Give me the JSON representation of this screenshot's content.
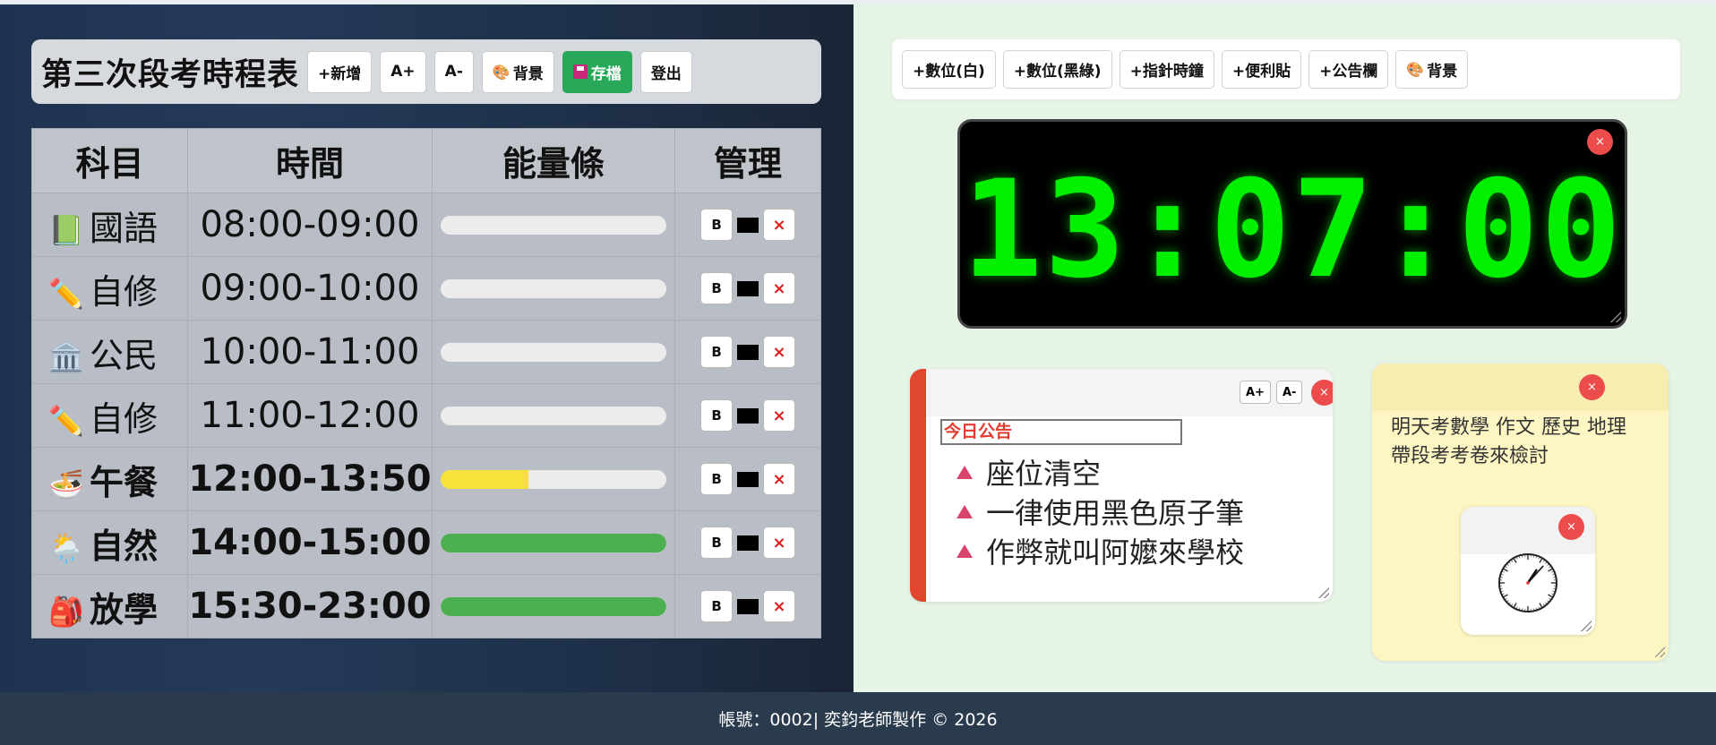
{
  "header": {
    "title": "第三次段考時程表",
    "buttons": {
      "add": "+新增",
      "font_up": "A+",
      "font_down": "A-",
      "background": "背景",
      "save": "存檔",
      "logout": "登出"
    }
  },
  "schedule": {
    "columns": [
      "科目",
      "時間",
      "能量條",
      "管理"
    ],
    "rows": [
      {
        "icon": "📗",
        "icon_name": "green-book-icon",
        "subject": "國語",
        "time": "08:00-09:00",
        "progress": 0,
        "bar_color": "#f1d62a",
        "bold": false
      },
      {
        "icon": "✏️",
        "icon_name": "pencil-icon",
        "subject": "自修",
        "time": "09:00-10:00",
        "progress": 0,
        "bar_color": "#f1d62a",
        "bold": false
      },
      {
        "icon": "🏛️",
        "icon_name": "classical-building-icon",
        "subject": "公民",
        "time": "10:00-11:00",
        "progress": 0,
        "bar_color": "#f1d62a",
        "bold": false
      },
      {
        "icon": "✏️",
        "icon_name": "pencil-icon",
        "subject": "自修",
        "time": "11:00-12:00",
        "progress": 0,
        "bar_color": "#f1d62a",
        "bold": false
      },
      {
        "icon": "🍜",
        "icon_name": "noodle-bowl-icon",
        "subject": "午餐",
        "time": "12:00-13:50",
        "progress": 39,
        "bar_color": "#f7e23b",
        "bold": true
      },
      {
        "icon": "🌦️",
        "icon_name": "sun-rain-cloud-icon",
        "subject": "自然",
        "time": "14:00-15:00",
        "progress": 100,
        "bar_color": "#4caf50",
        "bold": true
      },
      {
        "icon": "🎒",
        "icon_name": "backpack-icon",
        "subject": "放學",
        "time": "15:30-23:00",
        "progress": 100,
        "bar_color": "#4caf50",
        "bold": true
      }
    ],
    "mgmt": {
      "bold_label": "B",
      "delete_label": "×"
    }
  },
  "widgets_toolbar": {
    "buttons": [
      "+數位(白)",
      "+數位(黑綠)",
      "+指針時鐘",
      "+便利貼",
      "+公告欄"
    ],
    "background": "背景"
  },
  "digital_clock": {
    "time": "13:07:00",
    "close": "×"
  },
  "notice_board": {
    "font_up": "A+",
    "font_down": "A-",
    "close": "×",
    "title": "今日公告",
    "items": [
      "座位清空",
      "一律使用黑色原子筆",
      "作弊就叫阿嬤來學校"
    ]
  },
  "sticky_note": {
    "close": "×",
    "lines": [
      "明天考數學 作文 歷史 地理",
      "帶段考考卷來檢討"
    ]
  },
  "analog_clock": {
    "close": "×",
    "hour": 13,
    "minute": 7
  },
  "footer": {
    "text": "帳號：0002| 奕鈞老師製作 © 2026"
  },
  "colors": {
    "accent_save": "#29a85a",
    "notice_border": "#e0472e",
    "digital_green": "#00f000",
    "close_red": "#ec4c4c"
  }
}
